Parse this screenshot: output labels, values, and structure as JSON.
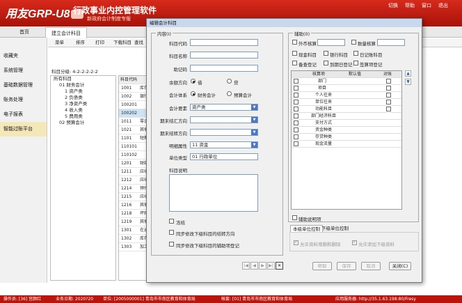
{
  "header": {
    "logo": "用友GRP-U8",
    "title": "行政事业内控管理软件",
    "subtitle": "新政府会计制度专版",
    "menu": [
      "切换",
      "帮助",
      "窗口",
      "退出"
    ]
  },
  "nav": {
    "tabs": [
      "首页",
      "建立会计科目"
    ]
  },
  "sidebar": {
    "items": [
      "收藏夹",
      "系统管理",
      "基础数据管理",
      "账务处理",
      "电子报表",
      "智能过账平台"
    ]
  },
  "toolbar": {
    "items": [
      "菜单",
      "排序",
      "打印",
      "下载科目",
      "查找"
    ]
  },
  "tree": {
    "level_label": "科目分级: 4-2-2-2-2-2",
    "items": [
      "所有科目",
      "01 财务会计",
      "1 资产类",
      "2 负债类",
      "3 净资产类",
      "4 收入类",
      "5 费用类",
      "02 预算会计"
    ]
  },
  "grid": {
    "header": "科目代码",
    "rows": [
      [
        "1001",
        "库存"
      ],
      [
        "1002",
        "银行"
      ],
      [
        "100201",
        ""
      ],
      [
        "100202",
        ""
      ],
      [
        "1011",
        "零余"
      ],
      [
        "1021",
        "其他"
      ],
      [
        "1101",
        "短期"
      ],
      [
        "110101",
        ""
      ],
      [
        "110102",
        ""
      ],
      [
        "1201",
        "财政"
      ],
      [
        "1211",
        "应收"
      ],
      [
        "1212",
        "应收"
      ],
      [
        "1214",
        "预付"
      ],
      [
        "1215",
        "应收"
      ],
      [
        "1216",
        "其他"
      ],
      [
        "1218",
        "坏账"
      ],
      [
        "1219",
        "其他"
      ],
      [
        "1301",
        "在途"
      ],
      [
        "1302",
        "库存"
      ],
      [
        "1303",
        "加工"
      ]
    ]
  },
  "dialog": {
    "title": "编辑会计科目",
    "content_group": "内容(I)",
    "fields": {
      "code_label": "科目代码",
      "code_value": "",
      "name_label": "科目名称",
      "name_value": "",
      "mnemonic_label": "助记码",
      "mnemonic_value": "",
      "balance_label": "余额方向",
      "balance_debit": "借",
      "balance_credit": "贷",
      "system_label": "会计体系",
      "system_fin": "财务会计",
      "system_budget": "预算会计",
      "element_label": "会计要素",
      "element_value": "资产类",
      "reverse_label": "期末结汇方向",
      "reverse_value": "",
      "carry_label": "期末结转方向",
      "carry_value": "",
      "detail_label": "明细属性",
      "detail_value": "11 资金",
      "unit_label": "单位类型",
      "unit_value": "01 行政单位",
      "desc_label": "科目说明"
    },
    "checkboxes": [
      "冻结",
      "同步修改下级科目的结转方向",
      "同步修改下级科目的辅助项登记"
    ],
    "aux": {
      "group": "辅助(0)",
      "foreign": "外币核算",
      "quantity": "数量核算",
      "cash": "现金科目",
      "bank": "银行科目",
      "journal": "日记账科目",
      "memo": "备查登记",
      "expire": "到期日登记",
      "voucher": "签算项登记",
      "headers": [
        "核算项",
        "默认值",
        "对账"
      ],
      "items": [
        "部门",
        "项目",
        "个人往来",
        "单位往来",
        "功能科目",
        "部门经济科目",
        "支付方式",
        "资金种类",
        "存贷种类",
        "现金流量"
      ],
      "explain": "辅助说明项",
      "tabs": [
        "本级单位控制",
        "下级单位控制"
      ],
      "allow_delete": "允许资料增删和删除",
      "allow_add": "允许添加下级资料"
    },
    "buttons": {
      "help": "帮助",
      "save": "保存",
      "cancel": "取消",
      "close": "关闭(C)"
    }
  },
  "statusbar": {
    "operator": "操作员: [36] 宫颜红",
    "business_date": "业务日期: 2020?20",
    "unit": "单位: [2005000001] 青岛市市南区教育和体育局",
    "account_set": "帐套: [01] 青岛市市南区教育和体育局",
    "server": "应用服务器: http://35.1.63.198:80/Fresy"
  }
}
